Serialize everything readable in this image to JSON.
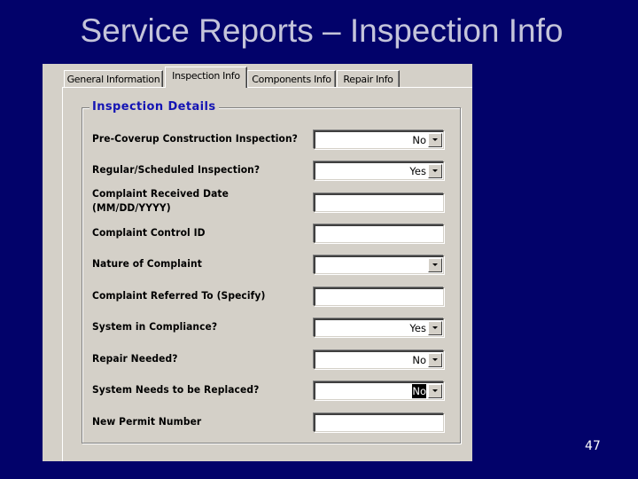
{
  "slide": {
    "title": "Service Reports – Inspection Info",
    "page_number": "47"
  },
  "tabs": [
    {
      "label": "General Information",
      "active": false
    },
    {
      "label": "Inspection Info",
      "active": true
    },
    {
      "label": "Components Info",
      "active": false
    },
    {
      "label": "Repair Info",
      "active": false
    }
  ],
  "group": {
    "title": "Inspection Details",
    "fields": [
      {
        "label": "Pre-Coverup Construction Inspection?",
        "type": "dropdown",
        "value": "No"
      },
      {
        "label": "Regular/Scheduled Inspection?",
        "type": "dropdown",
        "value": "Yes"
      },
      {
        "label": "Complaint Received Date",
        "label_line2": "(MM/DD/YYYY)",
        "type": "text",
        "value": ""
      },
      {
        "label": "Complaint Control ID",
        "type": "text",
        "value": ""
      },
      {
        "label": "Nature of Complaint",
        "type": "dropdown",
        "value": ""
      },
      {
        "label": "Complaint Referred To (Specify)",
        "type": "text",
        "value": ""
      },
      {
        "label": "System in Compliance?",
        "type": "dropdown",
        "value": "Yes"
      },
      {
        "label": "Repair Needed?",
        "type": "dropdown",
        "value": "No"
      },
      {
        "label": "System Needs to be Replaced?",
        "type": "dropdown",
        "value": "No",
        "selected": true
      },
      {
        "label": "New Permit Number",
        "type": "text",
        "value": ""
      }
    ]
  }
}
